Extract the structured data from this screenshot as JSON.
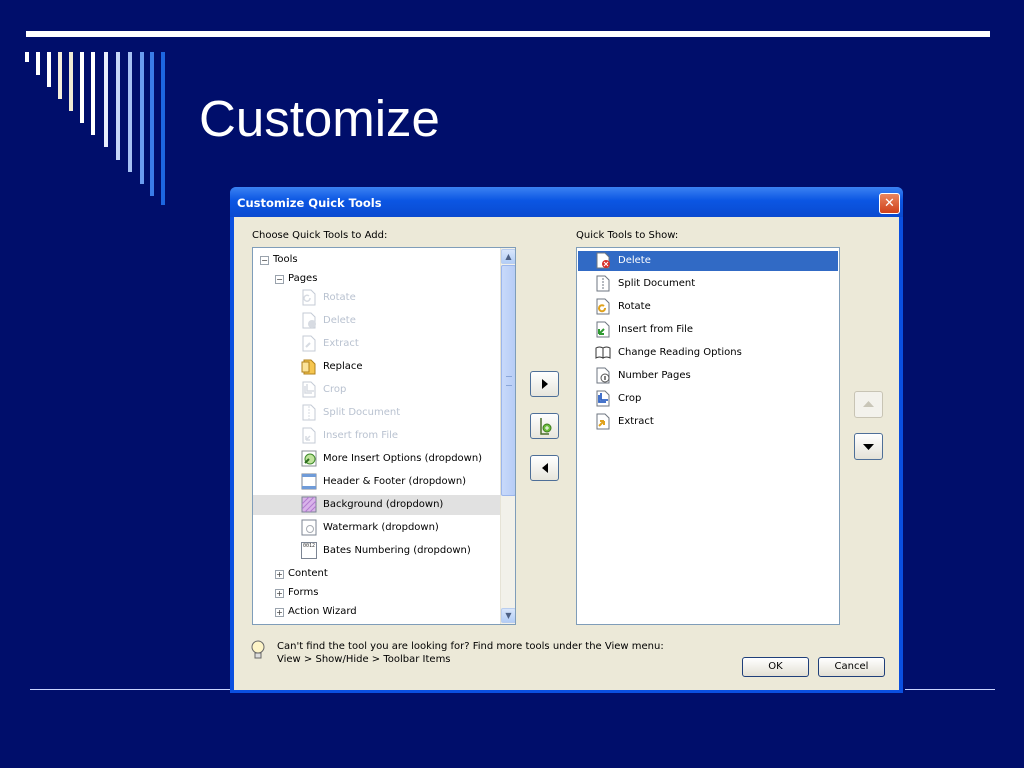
{
  "slide": {
    "title": "Customize"
  },
  "dialog": {
    "title": "Customize Quick Tools",
    "close_glyph": "✕",
    "add_label": "Choose Quick Tools to Add:",
    "show_label": "Quick Tools to Show:",
    "tree": {
      "root": "Tools",
      "pages": "Pages",
      "items": [
        {
          "label": "Rotate",
          "enabled": false,
          "icon": "rotate-icon"
        },
        {
          "label": "Delete",
          "enabled": false,
          "icon": "delete-page-icon"
        },
        {
          "label": "Extract",
          "enabled": false,
          "icon": "extract-icon"
        },
        {
          "label": "Replace",
          "enabled": true,
          "icon": "replace-icon"
        },
        {
          "label": "Crop",
          "enabled": false,
          "icon": "crop-icon"
        },
        {
          "label": "Split Document",
          "enabled": false,
          "icon": "split-document-icon"
        },
        {
          "label": "Insert from File",
          "enabled": false,
          "icon": "insert-from-file-icon"
        },
        {
          "label": "More Insert Options  (dropdown)",
          "enabled": true,
          "icon": "more-insert-options-icon"
        },
        {
          "label": "Header & Footer  (dropdown)",
          "enabled": true,
          "icon": "header-footer-icon"
        },
        {
          "label": "Background  (dropdown)",
          "enabled": true,
          "icon": "background-icon",
          "highlighted": true
        },
        {
          "label": "Watermark  (dropdown)",
          "enabled": true,
          "icon": "watermark-icon"
        },
        {
          "label": "Bates Numbering  (dropdown)",
          "enabled": true,
          "icon": "bates-numbering-icon",
          "icon_text": "0012"
        }
      ],
      "collapsed_groups": [
        "Content",
        "Forms",
        "Action Wizard"
      ]
    },
    "quick_tools": [
      {
        "label": "Delete",
        "selected": true,
        "icon": "delete-page-icon"
      },
      {
        "label": "Split Document",
        "icon": "split-document-icon"
      },
      {
        "label": "Rotate",
        "icon": "rotate-icon"
      },
      {
        "label": "Insert from File",
        "icon": "insert-from-file-icon"
      },
      {
        "label": "Change Reading Options",
        "icon": "book-icon"
      },
      {
        "label": "Number Pages",
        "icon": "number-pages-icon"
      },
      {
        "label": "Crop",
        "icon": "crop-icon"
      },
      {
        "label": "Extract",
        "icon": "extract-icon"
      }
    ],
    "hint": "Can't find the tool you are looking for? Find more tools under the View menu: View > Show/Hide > Toolbar Items",
    "ok_label": "OK",
    "cancel_label": "Cancel"
  },
  "colors": {
    "slide_background": "#000e6b",
    "title_bar": "#0b56e3",
    "selection": "#316ac5",
    "dialog_face": "#ece9d8"
  }
}
